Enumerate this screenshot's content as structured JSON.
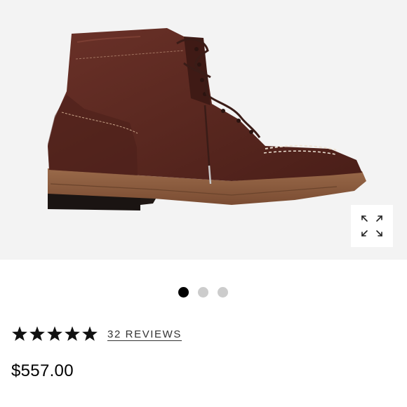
{
  "product": {
    "image_icon": "boot-photo",
    "expand_icon": "expand-arrows-icon",
    "carousel": {
      "count": 3,
      "active_index": 0
    },
    "rating": {
      "stars": 5,
      "max_stars": 5,
      "reviews_label": "32 REVIEWS"
    },
    "price": "$557.00"
  },
  "colors": {
    "background": "#ffffff",
    "image_background": "#f3f3f3",
    "leather": "#5b2a22",
    "sole": "#8a5c40",
    "dot_active": "#000000",
    "dot_inactive": "#cccccc",
    "text": "#000000"
  }
}
